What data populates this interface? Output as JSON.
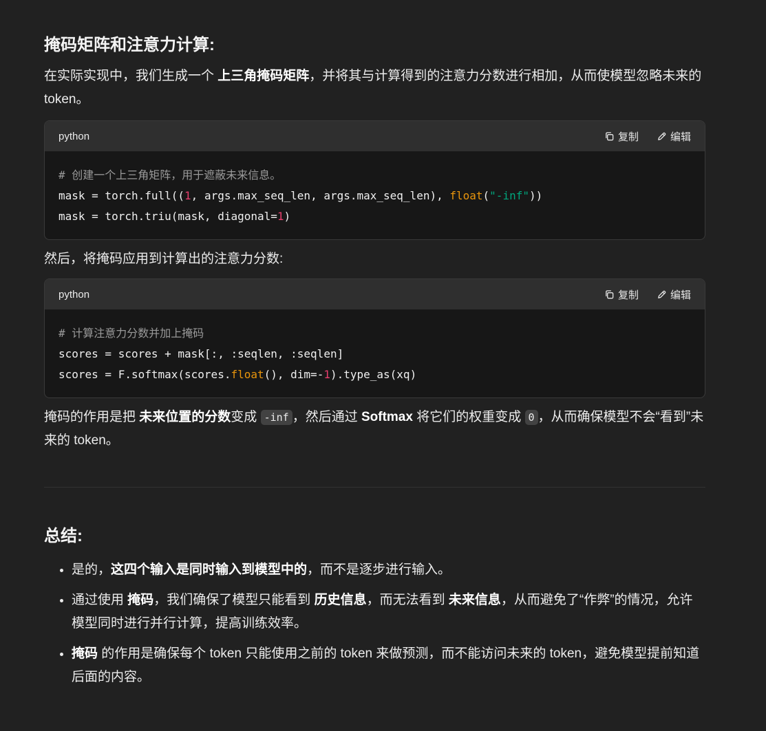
{
  "section1": {
    "heading": "掩码矩阵和注意力计算:",
    "intro": {
      "text1": "在实际实现中，我们生成一个 ",
      "bold1": "上三角掩码矩阵",
      "text2": "，并将其与计算得到的注意力分数进行相加，从而使模型忽略未来的 token。"
    },
    "code1": {
      "language": "python",
      "copy_label": "复制",
      "edit_label": "编辑",
      "line1_comment": "# 创建一个上三角矩阵，用于遮蔽未来信息。",
      "line2_a": "mask = torch.full((",
      "line2_num": "1",
      "line2_b": ", args.max_seq_len, args.max_seq_len), ",
      "line2_builtin": "float",
      "line2_c": "(",
      "line2_str": "\"-inf\"",
      "line2_d": "))",
      "line3_a": "mask = torch.triu(mask, diagonal=",
      "line3_num": "1",
      "line3_b": ")"
    },
    "then_text": "然后，将掩码应用到计算出的注意力分数:",
    "code2": {
      "language": "python",
      "copy_label": "复制",
      "edit_label": "编辑",
      "line1_comment": "# 计算注意力分数并加上掩码",
      "line2": "scores = scores + mask[:, :seqlen, :seqlen]",
      "line3_a": "scores = F.softmax(scores.",
      "line3_builtin": "float",
      "line3_b": "(), dim=-",
      "line3_num": "1",
      "line3_c": ").type_as(xq)"
    },
    "explain": {
      "text1": "掩码的作用是把 ",
      "bold1": "未来位置的分数",
      "text2": "变成 ",
      "code1": "-inf",
      "text3": "，然后通过 ",
      "bold2": "Softmax",
      "text4": " 将它们的权重变成 ",
      "code2": "0",
      "text5": "，从而确保模型不会“看到”未来的 token。"
    }
  },
  "summary": {
    "heading": "总结:",
    "items": [
      {
        "text1": "是的，",
        "bold1": "这四个输入是同时输入到模型中的",
        "text2": "，而不是逐步进行输入。"
      },
      {
        "text1": "通过使用 ",
        "bold1": "掩码",
        "text2": "，我们确保了模型只能看到 ",
        "bold2": "历史信息",
        "text3": "，而无法看到 ",
        "bold3": "未来信息",
        "text4": "，从而避免了“作弊”的情况，允许模型同时进行并行计算，提高训练效率。"
      },
      {
        "bold1": "掩码",
        "text1": " 的作用是确保每个 token 只能使用之前的 token 来做预测，而不能访问未来的 token，避免模型提前知道后面的内容。"
      }
    ]
  }
}
